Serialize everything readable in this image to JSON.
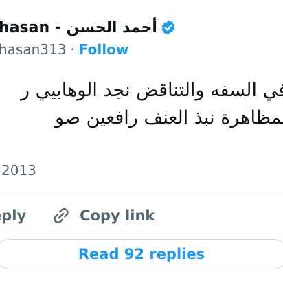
{
  "author": {
    "display_name": "hasan - أحمد الحسن",
    "handle": "hasan313",
    "separator": "·",
    "follow_label": "Follow",
    "verified_color": "#1d9bf0"
  },
  "tweet": {
    "text": "في السفه والتناقض نجد الوهابيي ر بمظاهرة نبذ العنف رافعين صو",
    "timestamp": "2013"
  },
  "actions": {
    "reply_label": "eply",
    "copy_link_label": "Copy link",
    "link_icon": "link-icon"
  },
  "footer": {
    "read_replies_label": "Read 92 replies"
  }
}
